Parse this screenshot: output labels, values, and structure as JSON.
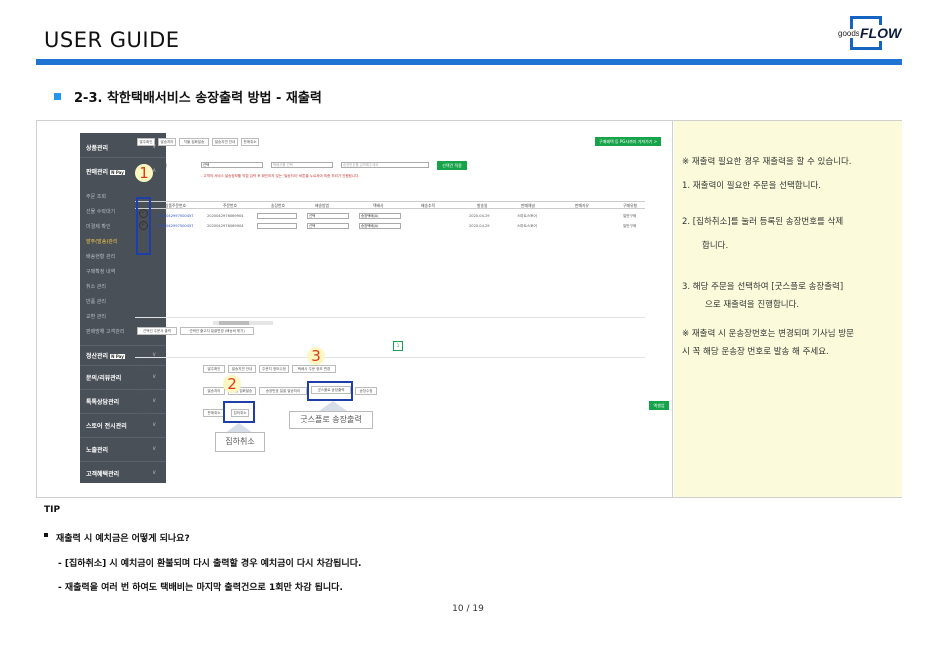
{
  "header": {
    "title": "USER GUIDE",
    "logo_small": "goods",
    "logo_big": "FLOW"
  },
  "section": {
    "title": "2-3.  착한택배서비스 송장출력 방법 - 재출력"
  },
  "screenshot": {
    "sidebar": {
      "groups": [
        "상품관리",
        "판매관리",
        "정산관리",
        "문의/리뷰관리",
        "톡톡상담관리",
        "스토어 전시관리",
        "노출관리",
        "고객혜택관리"
      ],
      "pay_badge": "N Pay",
      "sub_items": [
        "주문 조회",
        "선물 수락대기",
        "미결제 확인",
        "발주(발송)관리",
        "배송현황 관리",
        "구매확정 내역",
        "취소 관리",
        "반품 관리",
        "교환 관리",
        "판매방해 고객관리"
      ]
    },
    "toolbar_buttons": [
      "발주확인",
      "발송처리",
      "착불 집화발송",
      "발송지연 안내",
      "판매취소"
    ],
    "top_right_button": "구매혜택 등 PG사까지 가져가기 >",
    "filter": {
      "label": "일괄 입력",
      "select1": "선택",
      "select2": "택배사를 선택",
      "input_placeholder": "송장번호를 입력해주세요",
      "apply": "선택건 적용"
    },
    "warning_text": "- 고객의 서비스 발송정보를 직접 입력 후 확인하지 않는 '발송처리' 버튼을 누르셔야 최종 처리가 진행됩니다.",
    "table": {
      "headers": [
        "상품주문번호",
        "주문번호",
        "송장번호",
        "배송방법",
        "택배사",
        "배송추적",
        "발송일",
        "판매채널",
        "판매자유",
        "구매유형"
      ],
      "rows": [
        [
          "2020042997500457",
          "2020042976069904",
          "",
          "선택",
          "송장택배(A)",
          "",
          "2020.04.29",
          "스마트스토어",
          "",
          "일반구매"
        ],
        [
          "2020042997500457",
          "2020042976069904",
          "",
          "선택",
          "송장택배(A)",
          "",
          "2020.04.29",
          "스마트스토어",
          "",
          "일반구매"
        ]
      ]
    },
    "bottom_buttons": [
      "선택건 주문서 출력",
      "선택건 출고지 일괄변경 (배송비 묶기)"
    ],
    "pager": "1",
    "action_rows": [
      {
        "label": "주문확인",
        "buttons": [
          "발주확인",
          "발송지연 안내",
          "주문지 정보수정",
          "택배사 주문 정보 변경"
        ]
      },
      {
        "label": "발송처리",
        "buttons": [
          "발송처리",
          "착불 집화발송",
          "송장번호 일괄 발송처리",
          "굿스플로 송장출력",
          "송장수정"
        ]
      },
      {
        "label": "취소처리",
        "buttons": [
          "판매취소",
          "집하취소"
        ]
      }
    ],
    "right_green_button": "엑셀업",
    "markers": [
      "1",
      "2",
      "3"
    ],
    "callout_1": "집하취소",
    "callout_2": "굿스플로 송장출력"
  },
  "notes": {
    "lines": [
      "※ 재출력 필요한 경우 재출력을 할 수 있습니다.",
      "1.  재출력이 필요한 주문을 선택합니다.",
      "2.  [집하취소]를 눌러 등록된 송장번호를 삭제",
      "합니다.",
      "3.   해당 주문을 선택하여 [굿스플로 송장출력]",
      "으로  재출력을 진행합니다.",
      "※ 재출력 시 운송장번호는 변경되며 기사님 방문",
      "시 꼭 해당 운송장 번호로 발송 해 주세요."
    ]
  },
  "tip": {
    "title": "TIP",
    "question": "재출력 시 예치금은 어떻게 되나요?",
    "answers": [
      "- [집하취소] 시 예치금이 환불되며 다시 출력할 경우 예치금이 다시 차감됩니다.",
      "- 재출력을 여러 번 하여도 택배비는 마지막 출력건으로 1회만 차감 됩니다."
    ]
  },
  "page": "10 / 19",
  "colors": {
    "accent_blue": "#1f73d2",
    "highlight_box": "#1e3fa8",
    "marker_red": "#e03a1a",
    "notes_bg": "#fbfbdb",
    "sidebar_bg": "#4a5058",
    "green": "#16a34a"
  }
}
